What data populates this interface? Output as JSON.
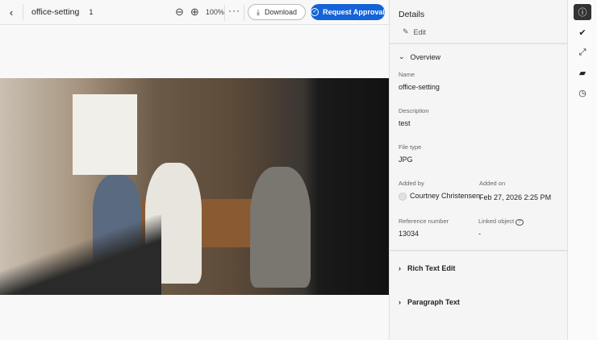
{
  "toolbar": {
    "back": "‹",
    "title": "office-setting",
    "count": "1",
    "zoom_out": "⊖",
    "zoom_in": "⊕",
    "zoom_level": "100%",
    "more": "···",
    "download": "Download",
    "download_icon": "⤓",
    "request_approval": "Request Approval"
  },
  "details": {
    "title": "Details",
    "edit": "Edit",
    "overview": {
      "label": "Overview",
      "name_label": "Name",
      "name": "office-setting",
      "description_label": "Description",
      "description": "test",
      "file_type_label": "File type",
      "file_type": "JPG",
      "added_by_label": "Added by",
      "added_by": "Courtney Christensen",
      "added_on_label": "Added on",
      "added_on": "Feb 27, 2026 2:25 PM",
      "reference_label": "Reference number",
      "reference": "13034",
      "linked_label": "Linked object",
      "linked": "-"
    },
    "sections": [
      "Rich Text Edit",
      "Paragraph Text"
    ]
  },
  "rail": [
    "info-icon",
    "approval-icon",
    "links-icon",
    "comments-icon",
    "history-icon"
  ],
  "colors": {
    "accent": "#1463d8"
  }
}
